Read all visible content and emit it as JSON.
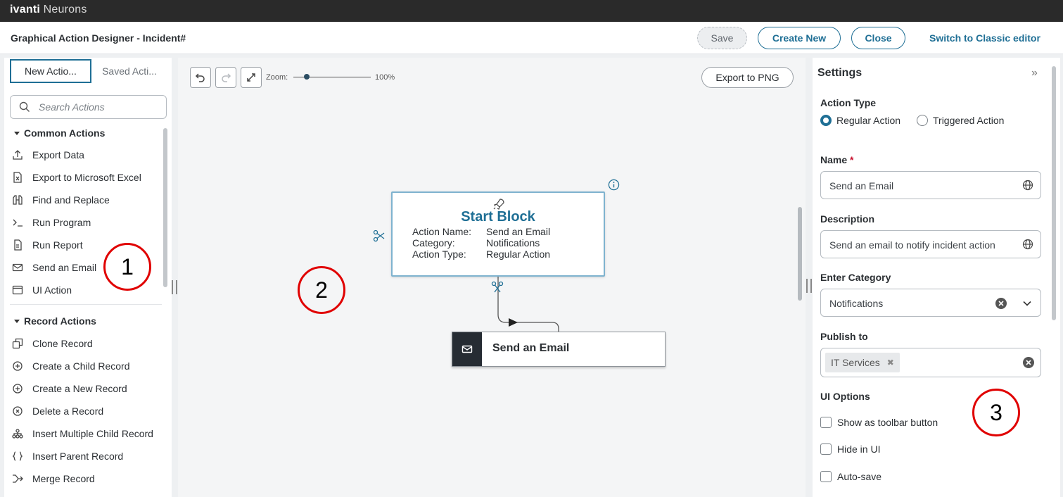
{
  "topbar": {
    "brand_bold": "ivanti",
    "brand_light": "Neurons"
  },
  "header": {
    "title": "Graphical Action Designer - Incident#",
    "save_label": "Save",
    "create_new_label": "Create New",
    "close_label": "Close",
    "switch_label": "Switch to Classic editor"
  },
  "left": {
    "tabs": [
      {
        "label": "New Actio..."
      },
      {
        "label": "Saved Acti..."
      }
    ],
    "search_placeholder": "Search Actions",
    "groups": [
      {
        "label": "Common Actions",
        "items": [
          {
            "label": "Export Data",
            "icon": "upload-icon"
          },
          {
            "label": "Export to Microsoft Excel",
            "icon": "excel-file-icon"
          },
          {
            "label": "Find and Replace",
            "icon": "binoculars-icon"
          },
          {
            "label": "Run Program",
            "icon": "terminal-icon"
          },
          {
            "label": "Run Report",
            "icon": "report-icon"
          },
          {
            "label": "Send an Email",
            "icon": "envelope-icon"
          },
          {
            "label": "UI Action",
            "icon": "window-icon"
          }
        ]
      },
      {
        "label": "Record Actions",
        "items": [
          {
            "label": "Clone Record",
            "icon": "clone-icon"
          },
          {
            "label": "Create a Child Record",
            "icon": "plus-circle-icon"
          },
          {
            "label": "Create a New Record",
            "icon": "plus-circle-icon"
          },
          {
            "label": "Delete a Record",
            "icon": "x-circle-icon"
          },
          {
            "label": "Insert Multiple Child Record",
            "icon": "hierarchy-icon"
          },
          {
            "label": "Insert Parent Record",
            "icon": "braces-icon"
          },
          {
            "label": "Merge Record",
            "icon": "merge-icon"
          }
        ]
      }
    ]
  },
  "canvas": {
    "zoom_label": "Zoom:",
    "zoom_value": "100%",
    "zoom_level": 0.17,
    "export_label": "Export to PNG",
    "start_block": {
      "title": "Start Block",
      "rows": [
        {
          "key": "Action Name:",
          "value": "Send an Email"
        },
        {
          "key": "Category:",
          "value": "Notifications"
        },
        {
          "key": "Action Type:",
          "value": "Regular Action"
        }
      ]
    },
    "email_node": {
      "label": "Send an Email"
    }
  },
  "settings": {
    "title": "Settings",
    "action_type_label": "Action Type",
    "radio_regular": "Regular Action",
    "radio_triggered": "Triggered Action",
    "name_label": "Name",
    "required_mark": "*",
    "name_value": "Send an Email",
    "description_label": "Description",
    "description_value": "Send an email to notify incident action",
    "category_label": "Enter Category",
    "category_value": "Notifications",
    "publish_label": "Publish to",
    "publish_chip": "IT Services",
    "ui_options_label": "UI Options",
    "checkbox_toolbar": "Show as toolbar button",
    "checkbox_hide": "Hide in UI",
    "checkbox_autosave": "Auto-save"
  },
  "callouts": {
    "one": "1",
    "two": "2",
    "three": "3"
  },
  "colors": {
    "accent": "#1f6f95",
    "callout": "#e00000",
    "topbar": "#2a2a2a"
  }
}
